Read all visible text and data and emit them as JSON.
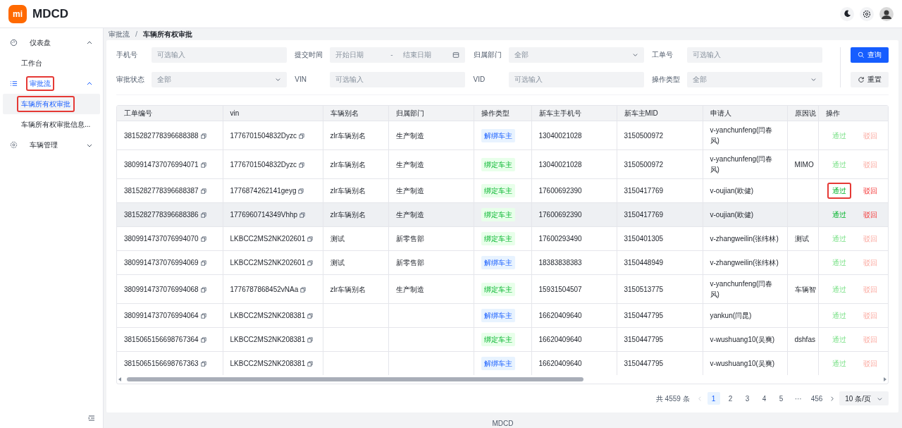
{
  "header": {
    "logo": "mi",
    "title": "MDCD"
  },
  "sidebar": {
    "items": [
      {
        "label": "仪表盘",
        "expanded": true,
        "children": [
          {
            "label": "工作台",
            "selected": false,
            "outlined": false
          }
        ],
        "outlined": false
      },
      {
        "label": "审批流",
        "expanded": true,
        "outlined": true,
        "children": [
          {
            "label": "车辆所有权审批",
            "selected": true,
            "outlined": true
          },
          {
            "label": "车辆所有权审批信息...",
            "selected": false,
            "outlined": false
          }
        ]
      },
      {
        "label": "车辆管理",
        "expanded": false,
        "outlined": false
      }
    ]
  },
  "breadcrumb": {
    "items": [
      "审批流",
      "车辆所有权审批"
    ],
    "separator": "/"
  },
  "filters": [
    {
      "label": "手机号",
      "kind": "input",
      "placeholder": "可选输入"
    },
    {
      "label": "提交时间",
      "kind": "daterange",
      "start_placeholder": "开始日期",
      "separator": "-",
      "end_placeholder": "结束日期"
    },
    {
      "label": "归属部门",
      "kind": "select",
      "value": "全部"
    },
    {
      "label": "工单号",
      "kind": "input",
      "placeholder": "可选输入"
    },
    {
      "label": "审批状态",
      "kind": "select",
      "value": "全部"
    },
    {
      "label": "VIN",
      "kind": "input",
      "placeholder": "可选输入"
    },
    {
      "label": "VID",
      "kind": "input",
      "placeholder": "可选输入"
    },
    {
      "label": "操作类型",
      "kind": "select",
      "value": "全部"
    }
  ],
  "buttons": {
    "search": "查询",
    "reset": "重置"
  },
  "table": {
    "columns": [
      "工单编号",
      "vin",
      "车辆别名",
      "归属部门",
      "操作类型",
      "新车主手机号",
      "新车主MID",
      "申请人",
      "原因说",
      "操作"
    ],
    "rows": [
      {
        "id": "3815282778396688388",
        "vin": "1776701504832Dyzc",
        "alias": "zlr车辆别名",
        "dept": "生产制造",
        "type": {
          "label": "解绑车主",
          "kind": "unbind"
        },
        "phone": "13040021028",
        "mid": "3150500972",
        "applicant": "v-yanchunfeng(闫春风)",
        "approve": "通过",
        "reject": "驳回",
        "disabled": true,
        "hovered": false,
        "approve_outlined": false
      },
      {
        "id": "3809914737076994071",
        "vin": "1776701504832Dyzc",
        "alias": "zlr车辆别名",
        "dept": "生产制造",
        "type": {
          "label": "绑定车主",
          "kind": "bind"
        },
        "phone": "13040021028",
        "mid": "3150500972",
        "applicant": "v-yanchunfeng(闫春风)",
        "reason": "MIMO",
        "approve": "通过",
        "reject": "驳回",
        "disabled": true,
        "hovered": false,
        "approve_outlined": false
      },
      {
        "id": "3815282778396688387",
        "vin": "1776874262141geyg",
        "alias": "zlr车辆别名",
        "dept": "生产制造",
        "type": {
          "label": "绑定车主",
          "kind": "bind"
        },
        "phone": "17600692390",
        "mid": "3150417769",
        "applicant": "v-oujian(欧健)",
        "approve": "通过",
        "reject": "驳回",
        "disabled": false,
        "hovered": false,
        "approve_outlined": true
      },
      {
        "id": "3815282778396688386",
        "vin": "1776960714349Vhhp",
        "alias": "zlr车辆别名",
        "dept": "生产制造",
        "type": {
          "label": "绑定车主",
          "kind": "bind"
        },
        "phone": "17600692390",
        "mid": "3150417769",
        "applicant": "v-oujian(欧健)",
        "approve": "通过",
        "reject": "驳回",
        "disabled": false,
        "hovered": true,
        "approve_outlined": false
      },
      {
        "id": "3809914737076994070",
        "vin": "LKBCC2MS2NK202601",
        "alias": "测试",
        "dept": "新零售部",
        "type": {
          "label": "绑定车主",
          "kind": "bind"
        },
        "phone": "17600293490",
        "mid": "3150401305",
        "applicant": "v-zhangweilin(张纬林)",
        "reason": "测试",
        "approve": "通过",
        "reject": "驳回",
        "disabled": true,
        "hovered": false,
        "approve_outlined": false
      },
      {
        "id": "3809914737076994069",
        "vin": "LKBCC2MS2NK202601",
        "alias": "测试",
        "dept": "新零售部",
        "type": {
          "label": "解绑车主",
          "kind": "unbind"
        },
        "phone": "18383838383",
        "mid": "3150448949",
        "applicant": "v-zhangweilin(张纬林)",
        "approve": "通过",
        "reject": "驳回",
        "disabled": true,
        "hovered": false,
        "approve_outlined": false
      },
      {
        "id": "3809914737076994068",
        "vin": "1776787868452vNAa",
        "alias": "zlr车辆别名",
        "dept": "生产制造",
        "type": {
          "label": "绑定车主",
          "kind": "bind"
        },
        "phone": "15931504507",
        "mid": "3150513775",
        "applicant": "v-yanchunfeng(闫春风)",
        "reason": "车辆智",
        "approve": "通过",
        "reject": "驳回",
        "disabled": true,
        "hovered": false,
        "approve_outlined": false
      },
      {
        "id": "3809914737076994064",
        "vin": "LKBCC2MS2NK208381",
        "type": {
          "label": "解绑车主",
          "kind": "unbind"
        },
        "phone": "16620409640",
        "mid": "3150447795",
        "applicant": "yankun(闫昆)",
        "approve": "通过",
        "reject": "驳回",
        "disabled": true,
        "hovered": false,
        "approve_outlined": false
      },
      {
        "id": "3815065156698767364",
        "vin": "LKBCC2MS2NK208381",
        "type": {
          "label": "绑定车主",
          "kind": "bind"
        },
        "phone": "16620409640",
        "mid": "3150447795",
        "applicant": "v-wushuang10(吴爽)",
        "reason": "dshfas",
        "approve": "通过",
        "reject": "驳回",
        "disabled": true,
        "hovered": false,
        "approve_outlined": false
      },
      {
        "id": "3815065156698767363",
        "vin": "LKBCC2MS2NK208381",
        "type": {
          "label": "解绑车主",
          "kind": "unbind"
        },
        "phone": "16620409640",
        "mid": "3150447795",
        "applicant": "v-wushuang10(吴爽)",
        "approve": "通过",
        "reject": "驳回",
        "disabled": true,
        "hovered": false,
        "approve_outlined": false
      }
    ]
  },
  "pagination": {
    "total": "共 4559 条",
    "pages": [
      {
        "label": "1",
        "selected": true
      },
      {
        "label": "2",
        "selected": false
      },
      {
        "label": "3",
        "selected": false
      },
      {
        "label": "4",
        "selected": false
      },
      {
        "label": "5",
        "selected": false
      },
      {
        "label": "···",
        "selected": false
      },
      {
        "label": "456",
        "selected": false
      }
    ],
    "page_size": "10 条/页"
  },
  "footer": "MDCD"
}
